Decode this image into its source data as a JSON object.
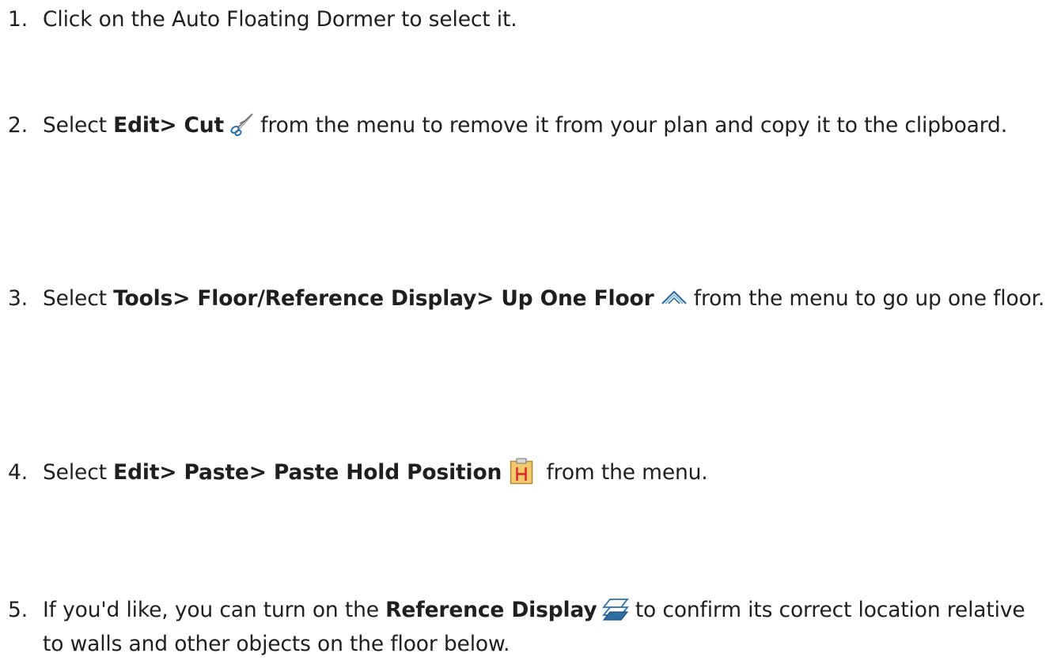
{
  "steps": [
    {
      "number": "1.",
      "text": "Click on the Auto Floating Dormer to select it."
    },
    {
      "number": "2.",
      "before": "Select ",
      "bold": "Edit> Cut",
      "icon": "scissors-icon",
      "after": " from the menu to remove it from your plan and copy it to the clipboard."
    },
    {
      "number": "3.",
      "before": "Select ",
      "bold": "Tools> Floor/Reference Display> Up One Floor",
      "icon": "up-one-floor-icon",
      "after": " from the menu to go up one floor."
    },
    {
      "number": "4.",
      "before": "Select ",
      "bold": "Edit> Paste> Paste Hold Position",
      "icon": "paste-hold-position-icon",
      "after": " from the menu."
    },
    {
      "number": "5.",
      "before": "If you'd like, you can turn on the ",
      "bold": "Reference Display",
      "icon": "reference-display-icon",
      "after": " to confirm its correct location relative to walls and other objects on the floor below."
    }
  ],
  "colors": {
    "text": "#1f1f1f",
    "icon_blue": "#2e6fa3",
    "paste_icon_bg": "#f3c96b",
    "paste_icon_letter": "#d9232a"
  }
}
